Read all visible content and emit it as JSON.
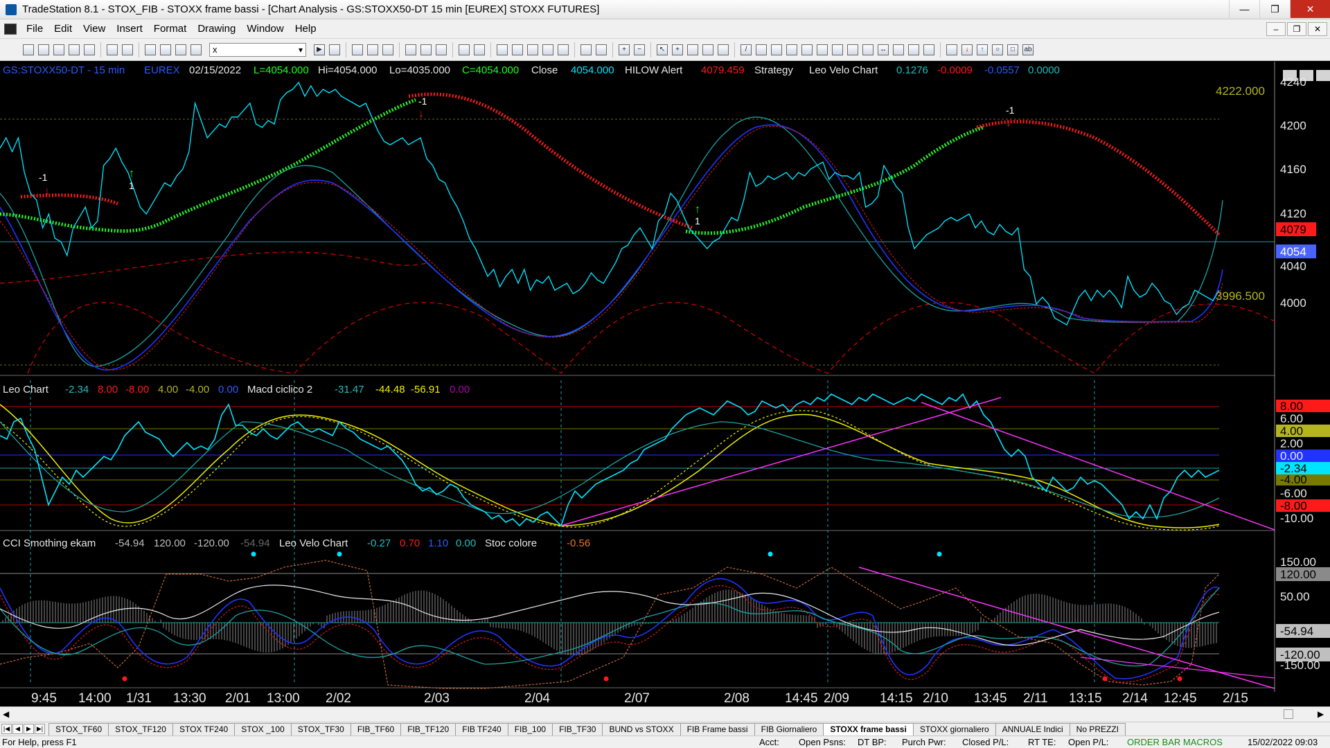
{
  "window": {
    "title": "TradeStation 8.1 - STOX_FIB - STOXX frame bassi - [Chart Analysis - GS:STOXX50-DT  15 min  [EUREX] STOXX FUTURES]"
  },
  "menu": [
    "File",
    "Edit",
    "View",
    "Insert",
    "Format",
    "Drawing",
    "Window",
    "Help"
  ],
  "toolbar": {
    "symbol_value": "x"
  },
  "chart": {
    "header": {
      "symbol": "GS:STOXX50-DT - 15 min",
      "exchange": "EUREX",
      "date": "02/15/2022",
      "last": "L=4054.000",
      "high": "Hi=4054.000",
      "low": "Lo=4035.000",
      "close_eq": "C=4054.000",
      "close_label": "Close",
      "close_value": "4054.000",
      "alert_label": "HILOW Alert",
      "alert_value": "4079.459",
      "strategy_label": "Strategy",
      "velo_label": "Leo Velo Chart",
      "velo_v1": "0.1276",
      "velo_v2": "-0.0009",
      "velo_v3": "-0.0557",
      "velo_v4": "0.0000"
    },
    "price_axis": [
      "4240",
      "4200",
      "4160",
      "4120",
      "4080",
      "4040",
      "4000"
    ],
    "price_marks": {
      "top_level": "4222.000",
      "bottom_level": "3996.500",
      "alert_badge": "4079",
      "last_badge": "4054"
    },
    "signal_labels": [
      "-1",
      "1",
      "-1",
      "1",
      "-1"
    ],
    "panel2": {
      "leo_label": "Leo Chart",
      "leo_vals": [
        "-2.34",
        "8.00",
        "-8.00",
        "4.00",
        "-4.00",
        "0.00"
      ],
      "macd_label": "Macd ciclico 2",
      "macd_vals": [
        "-31.47",
        "-44.48",
        "-56.91",
        "0.00"
      ],
      "axis": [
        "8.00",
        "6.00",
        "4.00",
        "2.00",
        "0.00",
        "-2.34",
        "-4.00",
        "-6.00",
        "-8.00",
        "-10.00"
      ]
    },
    "panel3": {
      "cci_label": "CCI Smothing ekam",
      "cci_vals": [
        "-54.94",
        "120.00",
        "-120.00",
        "-54.94"
      ],
      "velo_label": "Leo Velo Chart",
      "velo_vals": [
        "-0.27",
        "0.70",
        "1.10",
        "0.00"
      ],
      "stoc_label": "Stoc colore",
      "stoc_val": "-0.56",
      "axis": [
        "150.00",
        "120.00",
        "50.00",
        "-54.94",
        "-120.00",
        "-150.00"
      ]
    },
    "time_axis": [
      "9:45",
      "14:00",
      "1/31",
      "13:30",
      "2/01",
      "13:00",
      "2/02",
      "2/03",
      "2/04",
      "2/07",
      "2/08",
      "14:45",
      "2/09",
      "14:15",
      "2/10",
      "13:45",
      "2/11",
      "13:15",
      "2/14",
      "12:45",
      "2/15"
    ]
  },
  "tabs": [
    "STOX_TF60",
    "STOX_TF120",
    "STOX TF240",
    "STOX _100",
    "STOX_TF30",
    "FIB_TF60",
    "FIB_TF120",
    "FIB TF240",
    "FIB_100",
    "FIB_TF30",
    "BUND vs STOXX",
    "FIB Frame bassi",
    "FIB Giornaliero",
    "STOXX frame bassi",
    "STOXX giornaliero",
    "ANNUALE Indici",
    "No PREZZI"
  ],
  "active_tab": "STOXX frame bassi",
  "status": {
    "help": "For Help, press F1",
    "acct": "Acct:",
    "open_psns": "Open Psns:",
    "dt_bp": "DT BP:",
    "purch_pwr": "Purch Pwr:",
    "closed_pl": "Closed P/L:",
    "rt_te": "RT TE:",
    "open_pl": "Open P/L:",
    "macros": "ORDER BAR  MACROS",
    "datetime": "15/02/2022 09:03"
  },
  "colors": {
    "cyan": "#00e5ff",
    "green": "#22ff22",
    "red": "#ff1a1a",
    "blue": "#2233ff",
    "teal": "#1ca3a3",
    "yellow": "#f0f000",
    "magenta": "#ff33ff",
    "olive": "#b5b521",
    "teal_text": "#1fbfbf",
    "gray_text": "#bfbfbf",
    "dark_red": "#c40000"
  }
}
